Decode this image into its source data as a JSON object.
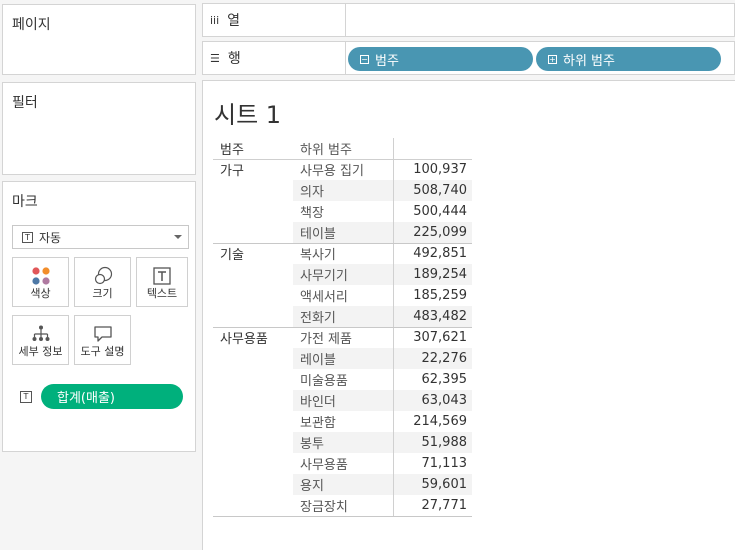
{
  "left": {
    "pages_title": "페이지",
    "filters_title": "필터",
    "marks_title": "마크",
    "mark_type": "자동",
    "mark_buttons": {
      "color": "색상",
      "size": "크기",
      "text": "텍스트",
      "detail": "세부 정보",
      "tooltip": "도구 설명"
    },
    "text_pill": "합계(매출)"
  },
  "shelves": {
    "columns_label": "열",
    "rows_label": "행",
    "row_pills": [
      "범주",
      "하위 범주"
    ]
  },
  "sheet": {
    "title": "시트 1",
    "headers": [
      "범주",
      "하위 범주",
      ""
    ],
    "groups": [
      {
        "category": "가구",
        "rows": [
          {
            "sub": "사무용 집기",
            "value": "100,937"
          },
          {
            "sub": "의자",
            "value": "508,740"
          },
          {
            "sub": "책장",
            "value": "500,444"
          },
          {
            "sub": "테이블",
            "value": "225,099"
          }
        ]
      },
      {
        "category": "기술",
        "rows": [
          {
            "sub": "복사기",
            "value": "492,851"
          },
          {
            "sub": "사무기기",
            "value": "189,254"
          },
          {
            "sub": "액세서리",
            "value": "185,259"
          },
          {
            "sub": "전화기",
            "value": "483,482"
          }
        ]
      },
      {
        "category": "사무용품",
        "rows": [
          {
            "sub": "가전 제품",
            "value": "307,621"
          },
          {
            "sub": "레이블",
            "value": "22,276"
          },
          {
            "sub": "미술용품",
            "value": "62,395"
          },
          {
            "sub": "바인더",
            "value": "63,043"
          },
          {
            "sub": "보관함",
            "value": "214,569"
          },
          {
            "sub": "봉투",
            "value": "51,988"
          },
          {
            "sub": "사무용품",
            "value": "71,113"
          },
          {
            "sub": "용지",
            "value": "59,601"
          },
          {
            "sub": "장금장치",
            "value": "27,771"
          }
        ]
      }
    ]
  },
  "colors": {
    "blue_pill": "#4996b2",
    "green_pill": "#00b07c"
  }
}
